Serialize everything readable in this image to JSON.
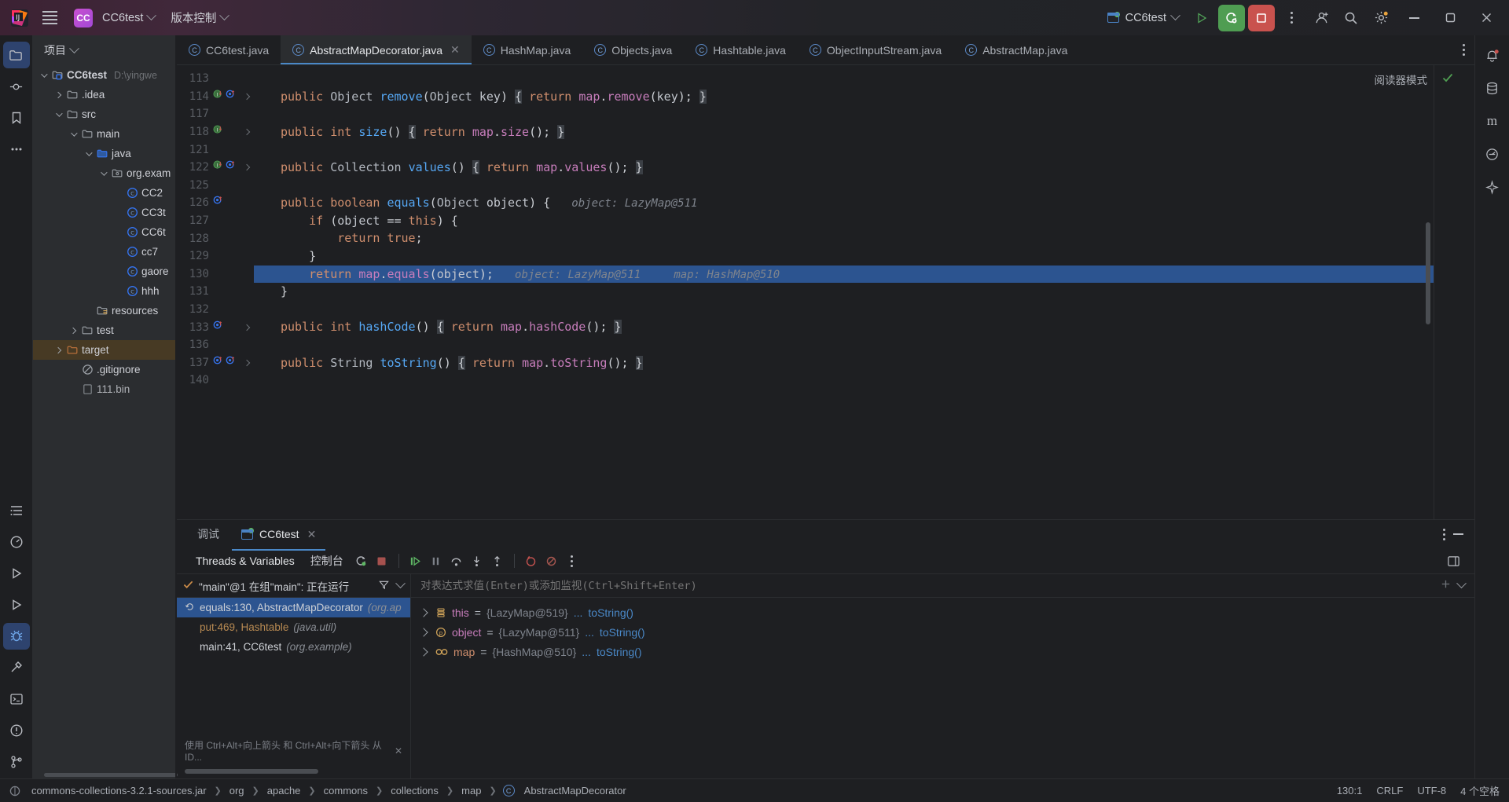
{
  "titlebar": {
    "logo_icon": "intellij-logo-icon",
    "menu_icon": "hamburger-menu-icon",
    "project_badge": "CC",
    "project_name": "CC6test",
    "vcs_label": "版本控制",
    "run_config_name": "CC6test",
    "run_icon": "run-triangle-icon",
    "debug_icon": "debug-restart-icon",
    "stop_icon": "stop-square-icon",
    "more_icon": "more-vertical-icon",
    "account_icon": "account-icon",
    "search_icon": "search-icon",
    "settings_icon": "gear-icon",
    "minimize_icon": "minimize-icon",
    "maximize_icon": "maximize-icon",
    "close_icon": "close-icon"
  },
  "rail_left": [
    {
      "name": "project-tool-icon",
      "glyph": "folder"
    },
    {
      "name": "commit-tool-icon",
      "glyph": "commit"
    },
    {
      "name": "bookmarks-tool-icon",
      "glyph": "bookmark"
    },
    {
      "name": "more-tools-icon",
      "glyph": "ellipsis"
    }
  ],
  "rail_left_bottom": [
    {
      "name": "structure-tool-icon",
      "glyph": "structure"
    },
    {
      "name": "profiler-tool-icon",
      "glyph": "meter"
    },
    {
      "name": "run-tool-icon",
      "glyph": "play"
    },
    {
      "name": "services-tool-icon",
      "glyph": "play2"
    },
    {
      "name": "debug-tool-icon",
      "glyph": "bug"
    },
    {
      "name": "build-tool-icon",
      "glyph": "hammer"
    },
    {
      "name": "terminal-tool-icon",
      "glyph": "terminal"
    },
    {
      "name": "problems-tool-icon",
      "glyph": "warning"
    },
    {
      "name": "vcs-tool-icon",
      "glyph": "branch"
    }
  ],
  "rail_right": [
    {
      "name": "notifications-icon",
      "glyph": "bell"
    },
    {
      "name": "database-icon",
      "glyph": "db"
    },
    {
      "name": "maven-icon",
      "glyph": "m"
    },
    {
      "name": "ai-assistant-icon",
      "glyph": "circle"
    },
    {
      "name": "sparkle-icon",
      "glyph": "sparkle"
    }
  ],
  "project_panel": {
    "title": "项目",
    "tree": [
      {
        "depth": 0,
        "arrow": "down",
        "icon": "project-folder-icon",
        "label": "CC6test",
        "path": "D:\\yingwe",
        "bold": true
      },
      {
        "depth": 1,
        "arrow": "right",
        "icon": "folder-icon",
        "label": ".idea",
        "path": ""
      },
      {
        "depth": 1,
        "arrow": "down",
        "icon": "folder-icon",
        "label": "src",
        "path": ""
      },
      {
        "depth": 2,
        "arrow": "down",
        "icon": "folder-icon",
        "label": "main",
        "path": ""
      },
      {
        "depth": 3,
        "arrow": "down",
        "icon": "source-folder-icon",
        "label": "java",
        "path": ""
      },
      {
        "depth": 4,
        "arrow": "down",
        "icon": "package-icon",
        "label": "org.exam",
        "path": ""
      },
      {
        "depth": 5,
        "arrow": "none",
        "icon": "java-class-icon",
        "label": "CC2",
        "path": ""
      },
      {
        "depth": 5,
        "arrow": "none",
        "icon": "java-class-icon",
        "label": "CC3t",
        "path": ""
      },
      {
        "depth": 5,
        "arrow": "none",
        "icon": "java-class-icon",
        "label": "CC6t",
        "path": ""
      },
      {
        "depth": 5,
        "arrow": "none",
        "icon": "java-class-icon",
        "label": "cc7",
        "path": ""
      },
      {
        "depth": 5,
        "arrow": "none",
        "icon": "java-class-icon",
        "label": "gaore",
        "path": ""
      },
      {
        "depth": 5,
        "arrow": "none",
        "icon": "java-class-icon",
        "label": "hhh",
        "path": ""
      },
      {
        "depth": 3,
        "arrow": "none",
        "icon": "resources-folder-icon",
        "label": "resources",
        "path": ""
      },
      {
        "depth": 2,
        "arrow": "right",
        "icon": "folder-icon",
        "label": "test",
        "path": ""
      },
      {
        "depth": 1,
        "arrow": "right",
        "icon": "target-folder-icon",
        "label": "target",
        "path": "",
        "highlight": true
      },
      {
        "depth": 2,
        "arrow": "none",
        "icon": "gitignore-icon",
        "label": ".gitignore",
        "path": ""
      },
      {
        "depth": 2,
        "arrow": "none",
        "icon": "file-icon",
        "label": "111.bin",
        "path": "",
        "clipped": true
      }
    ]
  },
  "editor_tabs": [
    {
      "label": "CC6test.java",
      "icon": "java-class-icon",
      "active": false,
      "closable": false
    },
    {
      "label": "AbstractMapDecorator.java",
      "icon": "java-class-icon",
      "active": true,
      "closable": true
    },
    {
      "label": "HashMap.java",
      "icon": "java-class-icon",
      "active": false,
      "closable": false
    },
    {
      "label": "Objects.java",
      "icon": "java-class-icon",
      "active": false,
      "closable": false
    },
    {
      "label": "Hashtable.java",
      "icon": "java-class-icon",
      "active": false,
      "closable": false
    },
    {
      "label": "ObjectInputStream.java",
      "icon": "java-class-icon",
      "active": false,
      "closable": false
    },
    {
      "label": "AbstractMap.java",
      "icon": "java-class-icon",
      "active": false,
      "closable": false
    }
  ],
  "editor": {
    "reader_mode_label": "阅读器模式",
    "inspection_ok_icon": "checkmark-icon",
    "lines": [
      {
        "num": "113",
        "marks": [],
        "expand": false,
        "html": "",
        "selected": false
      },
      {
        "num": "114",
        "marks": [
          "impl-green",
          "override-blue"
        ],
        "expand": true,
        "html": "<span class=\"kw\">public</span> <span class=\"ty\">Object</span> <span class=\"fn\">remove</span>(<span class=\"ty\">Object</span> <span class=\"pl\">key</span>) <span class=\"brace-hl\">{</span> <span class=\"kw\">return</span> <span class=\"vr\">map</span>.<span class=\"vr\">remove</span>(<span class=\"pl\">key</span>); <span class=\"brace-hl\">}</span>",
        "selected": false
      },
      {
        "num": "117",
        "marks": [],
        "expand": false,
        "html": "",
        "selected": false
      },
      {
        "num": "118",
        "marks": [
          "impl-green"
        ],
        "expand": true,
        "html": "<span class=\"kw\">public</span> <span class=\"kw\">int</span> <span class=\"fn\">size</span>() <span class=\"brace-hl\">{</span> <span class=\"kw\">return</span> <span class=\"vr\">map</span>.<span class=\"vr\">size</span>(); <span class=\"brace-hl\">}</span>",
        "selected": false
      },
      {
        "num": "121",
        "marks": [],
        "expand": false,
        "html": "",
        "selected": false
      },
      {
        "num": "122",
        "marks": [
          "impl-green",
          "override-blue"
        ],
        "expand": true,
        "html": "<span class=\"kw\">public</span> <span class=\"ty\">Collection</span> <span class=\"fn\">values</span>() <span class=\"brace-hl\">{</span> <span class=\"kw\">return</span> <span class=\"vr\">map</span>.<span class=\"vr\">values</span>(); <span class=\"brace-hl\">}</span>",
        "selected": false
      },
      {
        "num": "125",
        "marks": [],
        "expand": false,
        "html": "",
        "selected": false
      },
      {
        "num": "126",
        "marks": [
          "override-blue"
        ],
        "expand": false,
        "html": "<span class=\"kw\">public</span> <span class=\"kw\">boolean</span> <span class=\"fn\">equals</span>(<span class=\"ty\">Object</span> <span class=\"pl\">object</span>) {   <span class=\"hint\">object: LazyMap@511</span>",
        "selected": false
      },
      {
        "num": "127",
        "marks": [],
        "expand": false,
        "html": "    <span class=\"kw\">if</span> (<span class=\"pl\">object</span> == <span class=\"kw\">this</span>) {",
        "selected": false
      },
      {
        "num": "128",
        "marks": [],
        "expand": false,
        "html": "        <span class=\"kw\">return</span> <span class=\"kw\">true</span>;",
        "selected": false
      },
      {
        "num": "129",
        "marks": [],
        "expand": false,
        "html": "    }",
        "selected": false
      },
      {
        "num": "130",
        "marks": [],
        "expand": false,
        "html": "    <span class=\"kw\">return</span> <span class=\"vr\">map</span>.<span class=\"vr\">equals</span>(<span class=\"pl\">object</span>);   <span class=\"hint\">object: LazyMap@511     map: HashMap@510</span>",
        "selected": true
      },
      {
        "num": "131",
        "marks": [],
        "expand": false,
        "html": "}",
        "selected": false
      },
      {
        "num": "132",
        "marks": [],
        "expand": false,
        "html": "",
        "selected": false
      },
      {
        "num": "133",
        "marks": [
          "override-blue"
        ],
        "expand": true,
        "html": "<span class=\"kw\">public</span> <span class=\"kw\">int</span> <span class=\"fn\">hashCode</span>() <span class=\"brace-hl\">{</span> <span class=\"kw\">return</span> <span class=\"vr\">map</span>.<span class=\"vr\">hashCode</span>(); <span class=\"brace-hl\">}</span>",
        "selected": false
      },
      {
        "num": "136",
        "marks": [],
        "expand": false,
        "html": "",
        "selected": false
      },
      {
        "num": "137",
        "marks": [
          "override-blue",
          "override-blue2"
        ],
        "expand": true,
        "html": "<span class=\"kw\">public</span> <span class=\"ty\">String</span> <span class=\"fn\">toString</span>() <span class=\"brace-hl\">{</span> <span class=\"kw\">return</span> <span class=\"vr\">map</span>.<span class=\"vr\">toString</span>(); <span class=\"brace-hl\">}</span>",
        "selected": false
      },
      {
        "num": "140",
        "marks": [],
        "expand": false,
        "html": "",
        "selected": false
      }
    ]
  },
  "debug": {
    "tabs": [
      {
        "label": "调试",
        "icon": "",
        "active": false,
        "closable": false
      },
      {
        "label": "CC6test",
        "icon": "run-config-icon",
        "active": true,
        "closable": true
      }
    ],
    "options_icon": "more-vertical-icon",
    "minimize_icon": "minimize-icon",
    "toolbar": {
      "threads_tab": "Threads & Variables",
      "console_tab": "控制台",
      "rerun_icon": "rerun-icon",
      "stop_icon": "stop-icon",
      "resume_icon": "resume-icon",
      "pause_icon": "pause-icon",
      "step_over_icon": "step-over-icon",
      "step_into_icon": "step-into-icon",
      "step_out_icon": "step-out-icon",
      "breakpoints_icon": "view-breakpoints-icon",
      "mute_breakpoints_icon": "mute-breakpoints-icon",
      "more_icon": "more-vertical-icon",
      "layout_icon": "layout-settings-icon"
    },
    "thread_row": {
      "status_icon": "checkmark-icon",
      "label": "\"main\"@1 在组\"main\": 正在运行",
      "filter_icon": "filter-icon",
      "dropdown_icon": "chevron-down-icon"
    },
    "frames": [
      {
        "label": "equals:130, AbstractMapDecorator",
        "pkg": "(org.ap",
        "selected": true,
        "icon": "frame-restore-icon"
      },
      {
        "label": "put:469, Hashtable",
        "pkg": "(java.util)",
        "selected": false,
        "warn": true
      },
      {
        "label": "main:41, CC6test",
        "pkg": "(org.example)",
        "selected": false
      }
    ],
    "frames_hint": "使用 Ctrl+Alt+向上箭头 和 Ctrl+Alt+向下箭头 从 ID...",
    "frames_hint_close_icon": "close-icon",
    "watch_placeholder": "对表达式求值(Enter)或添加监视(Ctrl+Shift+Enter)",
    "watch_add_icon": "add-watch-icon",
    "watch_dropdown_icon": "chevron-down-icon",
    "variables": [
      {
        "icon": "field-icon",
        "icon_kind": "list",
        "name": "this",
        "value": "{LazyMap@519}",
        "ellipsis": "...",
        "link": "toString()"
      },
      {
        "icon": "param-icon",
        "icon_kind": "p",
        "name": "object",
        "value": "{LazyMap@511}",
        "ellipsis": "...",
        "link": "toString()"
      },
      {
        "icon": "field-icon",
        "icon_kind": "oo",
        "name": "map",
        "value": "{HashMap@510}",
        "ellipsis": "...",
        "link": "toString()"
      }
    ]
  },
  "statusbar": {
    "source_icon": "jar-icon",
    "source_label": "commons-collections-3.2.1-sources.jar",
    "breadcrumbs": [
      "org",
      "apache",
      "commons",
      "collections",
      "map"
    ],
    "class_icon": "java-class-icon",
    "class_name": "AbstractMapDecorator",
    "caret": "130:1",
    "line_sep": "CRLF",
    "encoding": "UTF-8",
    "indent": "4 个空格"
  },
  "colors": {
    "accent_blue": "#4a88c7",
    "selection_blue": "#2c5490",
    "green": "#4f9d52",
    "red": "#c9524e",
    "panel_bg": "#2b2d30",
    "editor_bg": "#1e1f22"
  }
}
